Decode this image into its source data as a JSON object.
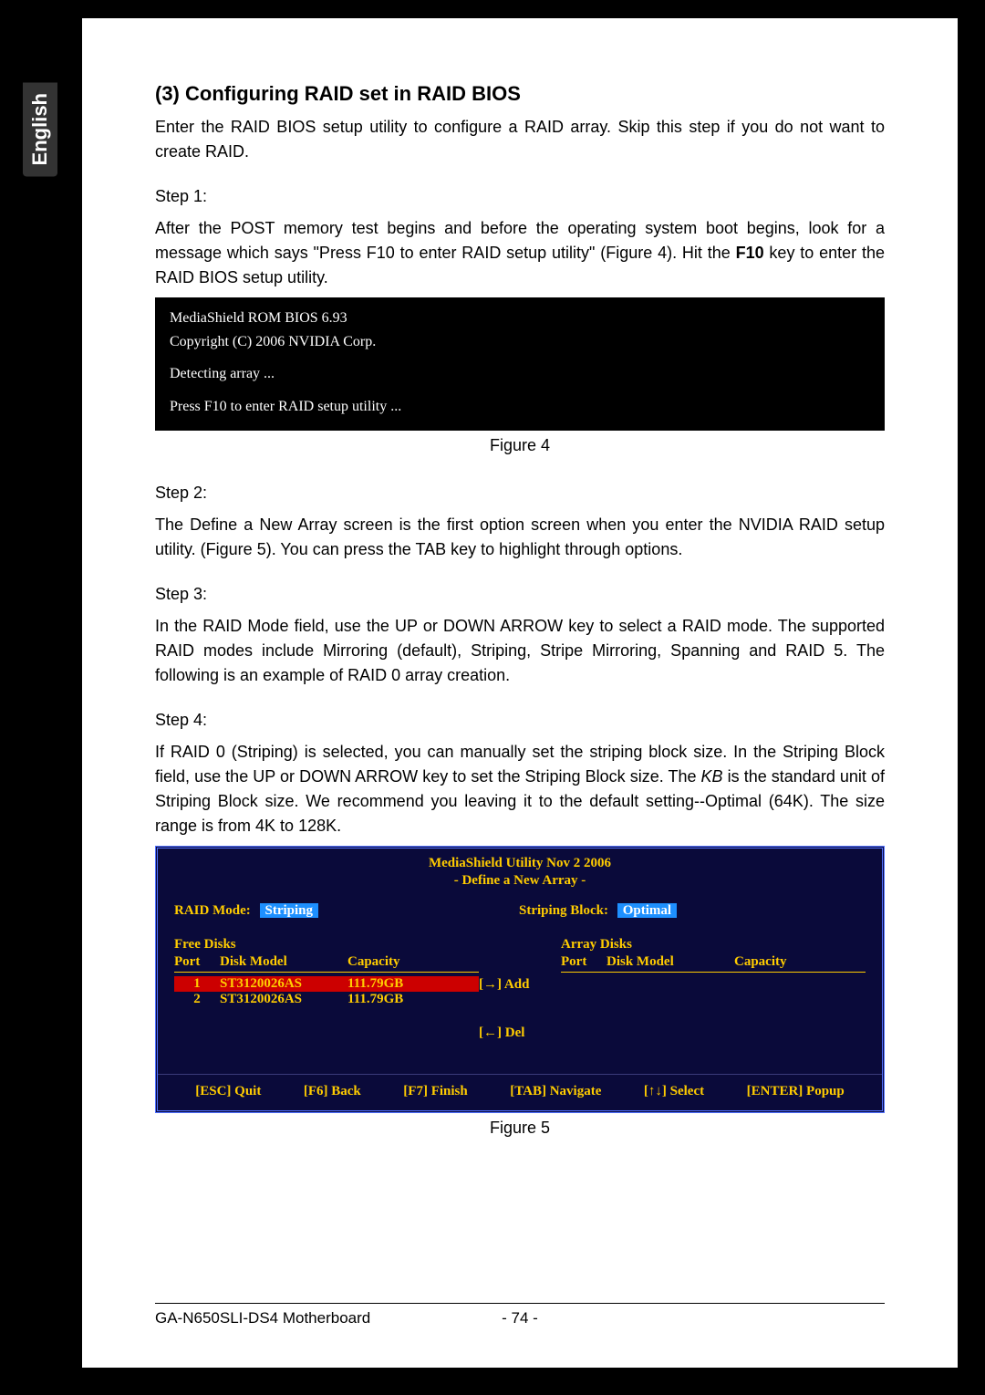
{
  "language_tab": "English",
  "section": {
    "title": "(3) Configuring RAID set in RAID BIOS",
    "intro": "Enter the RAID BIOS setup utility to configure a RAID array. Skip this step if you do not want to create RAID.",
    "step1_label": "Step 1:",
    "step1_pre": "After the POST memory test begins and before the operating system boot begins, look for a message which says \"Press F10 to enter RAID setup utility\" (Figure 4). Hit the ",
    "step1_bold": "F10",
    "step1_post": " key to enter the RAID BIOS setup utility.",
    "step2_label": "Step 2:",
    "step2_text": "The Define a New Array screen is the first option screen when you enter the NVIDIA RAID setup utility. (Figure 5). You can press the TAB key to highlight through options.",
    "step3_label": "Step 3:",
    "step3_text": "In the RAID Mode field, use the UP or DOWN ARROW key to select a RAID mode. The supported RAID modes include Mirroring (default), Striping, Stripe Mirroring, Spanning and RAID 5. The following is an example of RAID 0 array creation.",
    "step4_label": "Step 4:",
    "step4_pre": "If RAID 0 (Striping) is selected, you can manually set the striping block size. In the Striping Block field, use the UP or DOWN ARROW key to set the Striping Block size. The ",
    "step4_italic": "KB",
    "step4_post": " is the standard unit of Striping Block size.  We recommend you leaving it to the default setting--Optimal (64K). The size range is from 4K to 128K."
  },
  "bios_box": {
    "line1": "MediaShield ROM BIOS 6.93",
    "line2": "Copyright (C) 2006 NVIDIA Corp.",
    "line3": "Detecting array ...",
    "line4": "Press F10 to enter RAID setup utility ..."
  },
  "fig4_caption": "Figure 4",
  "fig5_caption": "Figure 5",
  "raid": {
    "title": "MediaShield Utility Nov 2 2006",
    "subtitle": "- Define a New Array -",
    "mode_label": "RAID Mode:",
    "mode_value": "Striping",
    "block_label": "Striping Block:",
    "block_value": "Optimal",
    "free_header": "Free Disks",
    "array_header": "Array Disks",
    "col_port": "Port",
    "col_model": "Disk Model",
    "col_capacity": "Capacity",
    "disks": [
      {
        "port": "1",
        "model": "ST3120026AS",
        "capacity": "111.79GB"
      },
      {
        "port": "2",
        "model": "ST3120026AS",
        "capacity": "111.79GB"
      }
    ],
    "add_label": "[→] Add",
    "del_label": "[←] Del",
    "footer": {
      "esc": "[ESC] Quit",
      "f6": "[F6] Back",
      "f7": "[F7] Finish",
      "tab": "[TAB] Navigate",
      "arrows": "[↑↓] Select",
      "enter": "[ENTER] Popup"
    }
  },
  "footer": {
    "product": "GA-N650SLI-DS4 Motherboard",
    "page_number": "- 74 -"
  }
}
